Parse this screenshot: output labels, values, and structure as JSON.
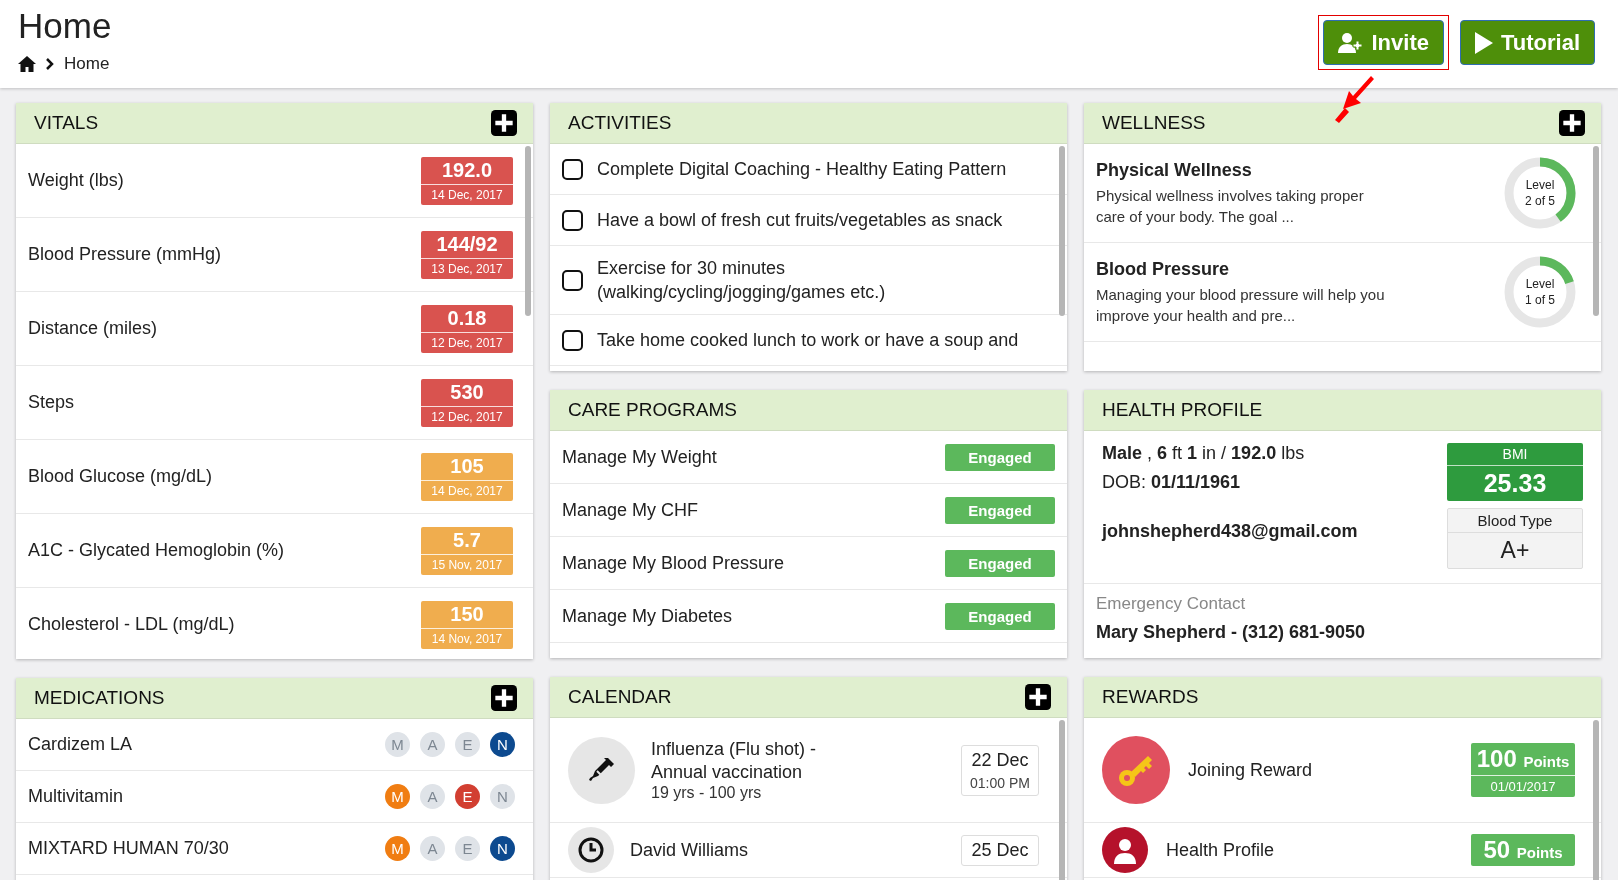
{
  "header": {
    "title": "Home",
    "breadcrumb": [
      "Home"
    ],
    "buttons": [
      {
        "label": "Invite",
        "kind": "invite",
        "highlighted": true
      },
      {
        "label": "Tutorial",
        "kind": "tutorial",
        "highlighted": false
      }
    ]
  },
  "vitals": {
    "title": "VITALS",
    "add_button": true,
    "rows": [
      {
        "name": "Weight (lbs)",
        "value": "192.0",
        "date": "14 Dec, 2017",
        "color": "#d9534f"
      },
      {
        "name": "Blood Pressure (mmHg)",
        "value": "144/92",
        "date": "13 Dec, 2017",
        "color": "#d9534f"
      },
      {
        "name": "Distance (miles)",
        "value": "0.18",
        "date": "12 Dec, 2017",
        "color": "#d9534f"
      },
      {
        "name": "Steps",
        "value": "530",
        "date": "12 Dec, 2017",
        "color": "#d9534f"
      },
      {
        "name": "Blood Glucose (mg/dL)",
        "value": "105",
        "date": "14 Dec, 2017",
        "color": "#f0ad4e"
      },
      {
        "name": "A1C - Glycated Hemoglobin (%)",
        "value": "5.7",
        "date": "15 Nov, 2017",
        "color": "#f0ad4e"
      },
      {
        "name": "Cholesterol - LDL (mg/dL)",
        "value": "150",
        "date": "14 Nov, 2017",
        "color": "#f0ad4e"
      }
    ]
  },
  "medications": {
    "title": "MEDICATIONS",
    "add_button": true,
    "rows": [
      {
        "name": "Cardizem LA",
        "doses": [
          {
            "label": "M",
            "active": false
          },
          {
            "label": "A",
            "active": false
          },
          {
            "label": "E",
            "active": false
          },
          {
            "label": "N",
            "active": true,
            "color": "#0d4a8f"
          }
        ]
      },
      {
        "name": "Multivitamin",
        "doses": [
          {
            "label": "M",
            "active": true,
            "color": "#f07d12"
          },
          {
            "label": "A",
            "active": false
          },
          {
            "label": "E",
            "active": true,
            "color": "#d23f31"
          },
          {
            "label": "N",
            "active": false
          }
        ]
      },
      {
        "name": "MIXTARD HUMAN 70/30",
        "doses": [
          {
            "label": "M",
            "active": true,
            "color": "#f07d12"
          },
          {
            "label": "A",
            "active": false
          },
          {
            "label": "E",
            "active": false
          },
          {
            "label": "N",
            "active": true,
            "color": "#0d4a8f"
          }
        ]
      }
    ]
  },
  "activities": {
    "title": "ACTIVITIES",
    "add_button": false,
    "items": [
      {
        "text": "Complete Digital Coaching - Healthy Eating Pattern",
        "checked": false
      },
      {
        "text": "Have a bowl of fresh cut fruits/vegetables as snack",
        "checked": false
      },
      {
        "text": "Exercise for 30 minutes (walking/cycling/jogging/games etc.)",
        "checked": false
      },
      {
        "text": "Take home cooked lunch to work or have a soup and",
        "checked": false
      }
    ]
  },
  "care_programs": {
    "title": "CARE PROGRAMS",
    "add_button": false,
    "rows": [
      {
        "name": "Manage My Weight",
        "status": "Engaged"
      },
      {
        "name": "Manage My CHF",
        "status": "Engaged"
      },
      {
        "name": "Manage My Blood Pressure",
        "status": "Engaged"
      },
      {
        "name": "Manage My Diabetes",
        "status": "Engaged"
      }
    ]
  },
  "calendar": {
    "title": "CALENDAR",
    "add_button": true,
    "items": [
      {
        "kind": "vaccination",
        "title": "Influenza (Flu shot) - Annual vaccination",
        "subtitle": "19 yrs - 100 yrs",
        "date": "22 Dec",
        "time": "01:00 PM"
      },
      {
        "kind": "appointment",
        "title": "David Williams",
        "date": "25 Dec"
      }
    ]
  },
  "wellness": {
    "title": "WELLNESS",
    "add_button": true,
    "items": [
      {
        "title": "Physical Wellness",
        "description": "Physical wellness involves taking proper care of your body. The goal ...",
        "level": 0.4,
        "level_label": "Level",
        "level_text": "2 of 5"
      },
      {
        "title": "Blood Pressure",
        "description": "Managing your blood pressure will help you improve your health and pre...",
        "level": 0.2,
        "level_label": "Level",
        "level_text": "1 of 5"
      }
    ]
  },
  "health_profile": {
    "title": "HEALTH PROFILE",
    "add_button": false,
    "summary": "**Male** , **6** ft **1** in / **192.0** lbs",
    "dob": "DOB: **01/11/1961**",
    "email": "johnshepherd438@gmail.com",
    "bmi_label": "BMI",
    "bmi_value": "25.33",
    "blood_type_label": "Blood Type",
    "blood_type": "A+",
    "emergency_label": "Emergency Contact",
    "emergency_contact": "Mary Shepherd - (312) 681-9050"
  },
  "rewards": {
    "title": "REWARDS",
    "add_button": false,
    "items": [
      {
        "kind": "key",
        "color": "#e0505f",
        "name": "Joining Reward",
        "points": "100",
        "unit": "Points",
        "date": "01/01/2017"
      },
      {
        "kind": "person",
        "color": "#b5122b",
        "name": "Health Profile",
        "points": "50",
        "unit": "Points"
      }
    ]
  }
}
